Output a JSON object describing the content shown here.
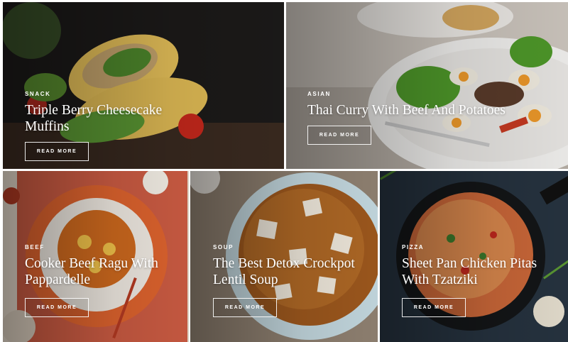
{
  "cards": [
    {
      "category": "SNACK",
      "title": "Triple Berry Cheesecake Muffins",
      "button": "READ MORE"
    },
    {
      "category": "ASIAN",
      "title": "Thai Curry With Beef And Potatoes",
      "button": "READ MORE"
    },
    {
      "category": "BEEF",
      "title": "Cooker Beef Ragu With Pappardelle",
      "button": "READ MORE"
    },
    {
      "category": "SOUP",
      "title": "The Best Detox Crockpot Lentil Soup",
      "button": "READ MORE"
    },
    {
      "category": "PIZZA",
      "title": "Sheet Pan Chicken Pitas With Tzatziki",
      "button": "READ MORE"
    }
  ],
  "colors": {
    "text": "#ffffff",
    "button_border": "#ffffff"
  }
}
